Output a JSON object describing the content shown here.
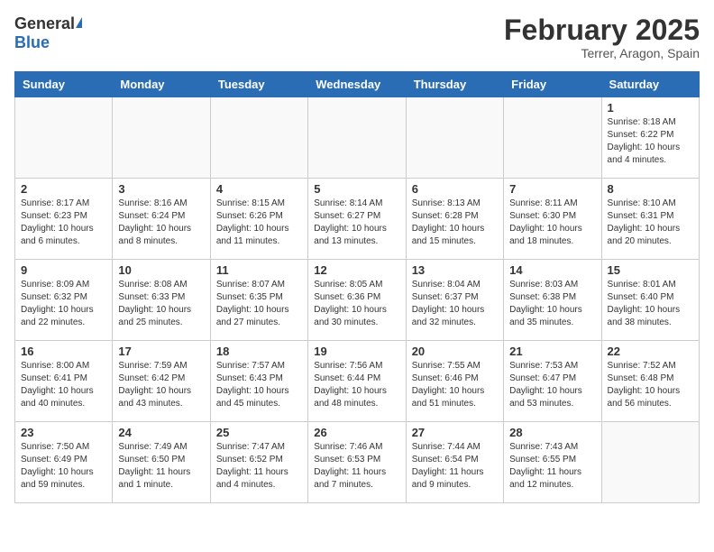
{
  "header": {
    "logo_general": "General",
    "logo_blue": "Blue",
    "month_title": "February 2025",
    "location": "Terrer, Aragon, Spain"
  },
  "weekdays": [
    "Sunday",
    "Monday",
    "Tuesday",
    "Wednesday",
    "Thursday",
    "Friday",
    "Saturday"
  ],
  "weeks": [
    [
      {
        "day": "",
        "info": ""
      },
      {
        "day": "",
        "info": ""
      },
      {
        "day": "",
        "info": ""
      },
      {
        "day": "",
        "info": ""
      },
      {
        "day": "",
        "info": ""
      },
      {
        "day": "",
        "info": ""
      },
      {
        "day": "1",
        "info": "Sunrise: 8:18 AM\nSunset: 6:22 PM\nDaylight: 10 hours and 4 minutes."
      }
    ],
    [
      {
        "day": "2",
        "info": "Sunrise: 8:17 AM\nSunset: 6:23 PM\nDaylight: 10 hours and 6 minutes."
      },
      {
        "day": "3",
        "info": "Sunrise: 8:16 AM\nSunset: 6:24 PM\nDaylight: 10 hours and 8 minutes."
      },
      {
        "day": "4",
        "info": "Sunrise: 8:15 AM\nSunset: 6:26 PM\nDaylight: 10 hours and 11 minutes."
      },
      {
        "day": "5",
        "info": "Sunrise: 8:14 AM\nSunset: 6:27 PM\nDaylight: 10 hours and 13 minutes."
      },
      {
        "day": "6",
        "info": "Sunrise: 8:13 AM\nSunset: 6:28 PM\nDaylight: 10 hours and 15 minutes."
      },
      {
        "day": "7",
        "info": "Sunrise: 8:11 AM\nSunset: 6:30 PM\nDaylight: 10 hours and 18 minutes."
      },
      {
        "day": "8",
        "info": "Sunrise: 8:10 AM\nSunset: 6:31 PM\nDaylight: 10 hours and 20 minutes."
      }
    ],
    [
      {
        "day": "9",
        "info": "Sunrise: 8:09 AM\nSunset: 6:32 PM\nDaylight: 10 hours and 22 minutes."
      },
      {
        "day": "10",
        "info": "Sunrise: 8:08 AM\nSunset: 6:33 PM\nDaylight: 10 hours and 25 minutes."
      },
      {
        "day": "11",
        "info": "Sunrise: 8:07 AM\nSunset: 6:35 PM\nDaylight: 10 hours and 27 minutes."
      },
      {
        "day": "12",
        "info": "Sunrise: 8:05 AM\nSunset: 6:36 PM\nDaylight: 10 hours and 30 minutes."
      },
      {
        "day": "13",
        "info": "Sunrise: 8:04 AM\nSunset: 6:37 PM\nDaylight: 10 hours and 32 minutes."
      },
      {
        "day": "14",
        "info": "Sunrise: 8:03 AM\nSunset: 6:38 PM\nDaylight: 10 hours and 35 minutes."
      },
      {
        "day": "15",
        "info": "Sunrise: 8:01 AM\nSunset: 6:40 PM\nDaylight: 10 hours and 38 minutes."
      }
    ],
    [
      {
        "day": "16",
        "info": "Sunrise: 8:00 AM\nSunset: 6:41 PM\nDaylight: 10 hours and 40 minutes."
      },
      {
        "day": "17",
        "info": "Sunrise: 7:59 AM\nSunset: 6:42 PM\nDaylight: 10 hours and 43 minutes."
      },
      {
        "day": "18",
        "info": "Sunrise: 7:57 AM\nSunset: 6:43 PM\nDaylight: 10 hours and 45 minutes."
      },
      {
        "day": "19",
        "info": "Sunrise: 7:56 AM\nSunset: 6:44 PM\nDaylight: 10 hours and 48 minutes."
      },
      {
        "day": "20",
        "info": "Sunrise: 7:55 AM\nSunset: 6:46 PM\nDaylight: 10 hours and 51 minutes."
      },
      {
        "day": "21",
        "info": "Sunrise: 7:53 AM\nSunset: 6:47 PM\nDaylight: 10 hours and 53 minutes."
      },
      {
        "day": "22",
        "info": "Sunrise: 7:52 AM\nSunset: 6:48 PM\nDaylight: 10 hours and 56 minutes."
      }
    ],
    [
      {
        "day": "23",
        "info": "Sunrise: 7:50 AM\nSunset: 6:49 PM\nDaylight: 10 hours and 59 minutes."
      },
      {
        "day": "24",
        "info": "Sunrise: 7:49 AM\nSunset: 6:50 PM\nDaylight: 11 hours and 1 minute."
      },
      {
        "day": "25",
        "info": "Sunrise: 7:47 AM\nSunset: 6:52 PM\nDaylight: 11 hours and 4 minutes."
      },
      {
        "day": "26",
        "info": "Sunrise: 7:46 AM\nSunset: 6:53 PM\nDaylight: 11 hours and 7 minutes."
      },
      {
        "day": "27",
        "info": "Sunrise: 7:44 AM\nSunset: 6:54 PM\nDaylight: 11 hours and 9 minutes."
      },
      {
        "day": "28",
        "info": "Sunrise: 7:43 AM\nSunset: 6:55 PM\nDaylight: 11 hours and 12 minutes."
      },
      {
        "day": "",
        "info": ""
      }
    ]
  ]
}
